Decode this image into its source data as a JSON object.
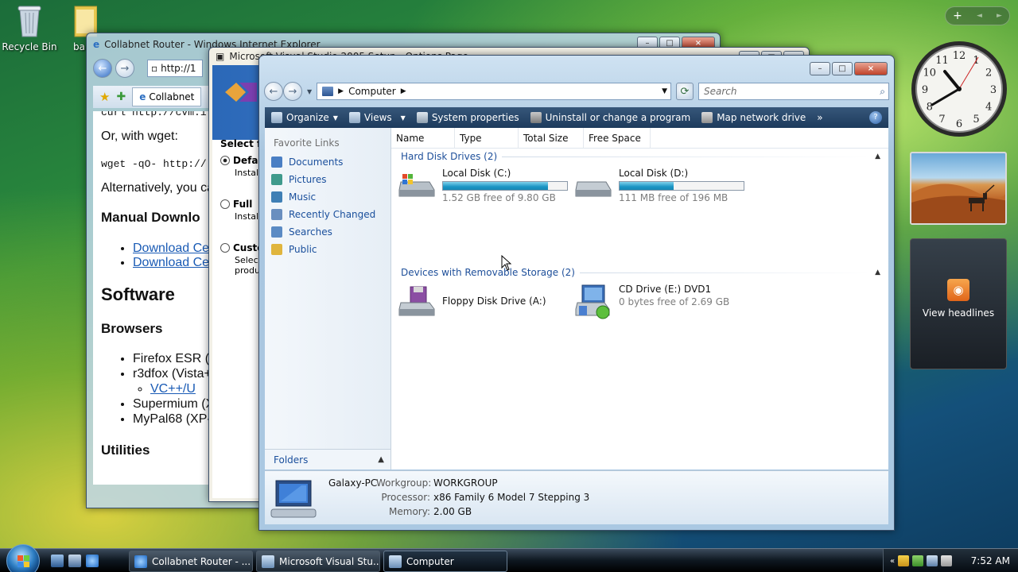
{
  "desktop": {
    "icons": [
      {
        "label": "Recycle Bin"
      },
      {
        "label": "ba"
      }
    ]
  },
  "ie_window": {
    "title": "Collabnet Router - Windows Internet Explorer",
    "address": "http://1",
    "tab_label": "Collabnet",
    "content": {
      "line1": "curl http://cvm.i",
      "line2": "Or, with wget:",
      "line3": "wget -qO- http://",
      "line4": "Alternatively, you ca",
      "heading1": "Manual Downlo",
      "links": [
        "Download Ce",
        "Download Ce"
      ],
      "heading2": "Software",
      "heading3": "Browsers",
      "browsers": [
        "Firefox ESR (",
        "r3dfox (Vista+",
        "Supermium (X",
        "MyPal68 (XP-"
      ],
      "sublink": "VC++/U",
      "heading4": "Utilities"
    }
  },
  "vs_window": {
    "title": "Microsoft Visual Studio 2005 Setup - Options Page",
    "select_label": "Select f",
    "options": [
      {
        "label": "Defau",
        "desc": "Installs"
      },
      {
        "label": "Full",
        "desc": "Installs"
      },
      {
        "label": "Custo",
        "desc": "Select\nproduc"
      }
    ]
  },
  "explorer": {
    "address": {
      "root_label": "Computer"
    },
    "search_placeholder": "Search",
    "commands": [
      "Organize",
      "Views",
      "System properties",
      "Uninstall or change a program",
      "Map network drive",
      "»"
    ],
    "help": "?",
    "nav": {
      "header": "Favorite Links",
      "links": [
        {
          "label": "Documents",
          "color": "#4a7fc4"
        },
        {
          "label": "Pictures",
          "color": "#3f9a8c"
        },
        {
          "label": "Music",
          "color": "#3f7fb5"
        },
        {
          "label": "Recently Changed",
          "color": "#6a8fbf"
        },
        {
          "label": "Searches",
          "color": "#5b8bc4"
        },
        {
          "label": "Public",
          "color": "#e0b53d"
        }
      ],
      "folders": "Folders"
    },
    "columns": [
      "Name",
      "Type",
      "Total Size",
      "Free Space"
    ],
    "groups": {
      "hdd": "Hard Disk Drives (2)",
      "removable": "Devices with Removable Storage (2)"
    },
    "drives": [
      {
        "name": "Local Disk (C:)",
        "free": "1.52 GB free of 9.80 GB",
        "used_fraction": 0.845
      },
      {
        "name": "Local Disk (D:)",
        "free": "111 MB free of 196 MB",
        "used_fraction": 0.434
      },
      {
        "name": "Floppy Disk Drive (A:)",
        "free": ""
      },
      {
        "name": "CD Drive (E:) DVD1",
        "free": "0 bytes free of 2.69 GB"
      }
    ],
    "details": {
      "pc_name": "Galaxy-PC",
      "workgroup_label": "Workgroup:",
      "workgroup": "WORKGROUP",
      "processor_label": "Processor:",
      "processor": "x86 Family 6 Model 7 Stepping 3",
      "memory_label": "Memory:",
      "memory": "2.00 GB"
    }
  },
  "gadgets": {
    "sidebar_ctrl": {
      "add": "+",
      "prev": "◄",
      "next": "►"
    },
    "feed_label": "View headlines",
    "clock_numbers": [
      "12",
      "1",
      "2",
      "3",
      "4",
      "5",
      "6",
      "7",
      "8",
      "9",
      "10",
      "11"
    ]
  },
  "taskbar": {
    "buttons": [
      "Collabnet Router - ...",
      "Microsoft Visual Stu...",
      "Computer"
    ],
    "time": "7:52 AM"
  }
}
